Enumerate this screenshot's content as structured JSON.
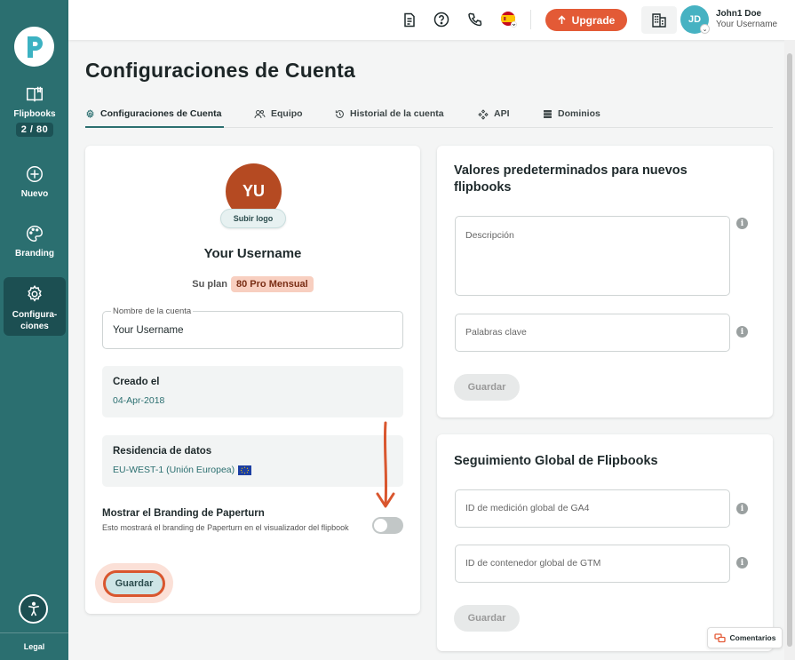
{
  "sidebar": {
    "items": [
      {
        "label": "Flipbooks",
        "count": "2 / 80"
      },
      {
        "label": "Nuevo"
      },
      {
        "label": "Branding"
      },
      {
        "label": "Configura-\nciones"
      }
    ],
    "legal": "Legal"
  },
  "topbar": {
    "upgrade_label": "Upgrade",
    "avatar_initials": "JD",
    "user_name": "John1 Doe",
    "user_sub": "Your Username"
  },
  "page": {
    "title": "Configuraciones de Cuenta",
    "tabs": [
      {
        "label": "Configuraciones de Cuenta",
        "icon": "gear-icon",
        "active": true
      },
      {
        "label": "Equipo",
        "icon": "users-icon"
      },
      {
        "label": "Historial de la cuenta",
        "icon": "history-icon"
      },
      {
        "label": "API",
        "icon": "api-icon"
      },
      {
        "label": "Dominios",
        "icon": "server-icon"
      }
    ]
  },
  "account_card": {
    "avatar_initials": "YU",
    "upload_logo_label": "Subir logo",
    "account_name": "Your Username",
    "plan_label": "Su plan",
    "plan_value": "80 Pro Mensual",
    "name_field_label": "Nombre de la cuenta",
    "name_field_value": "Your Username",
    "created_title": "Creado el",
    "created_value": "04-Apr-2018",
    "residency_title": "Residencia de datos",
    "residency_value": "EU-WEST-1 (Unión Europea)",
    "branding_title": "Mostrar el Branding de Paperturn",
    "branding_desc": "Esto mostrará el branding de Paperturn en el visualizador del flipbook",
    "branding_enabled": false,
    "save_label": "Guardar"
  },
  "defaults_card": {
    "title": "Valores predeterminados para nuevos flipbooks",
    "description_placeholder": "Descripción",
    "keywords_placeholder": "Palabras clave",
    "save_label": "Guardar"
  },
  "tracking_card": {
    "title": "Seguimiento Global de Flipbooks",
    "ga4_placeholder": "ID de medición global de GA4",
    "gtm_placeholder": "ID de contenedor global de GTM",
    "save_label": "Guardar"
  },
  "comments_label": "Comentarios",
  "colors": {
    "sidebar": "#2b6f70",
    "accent": "#e35a36",
    "avatar_top": "#46b2c2",
    "avatar_account": "#b54a22"
  }
}
